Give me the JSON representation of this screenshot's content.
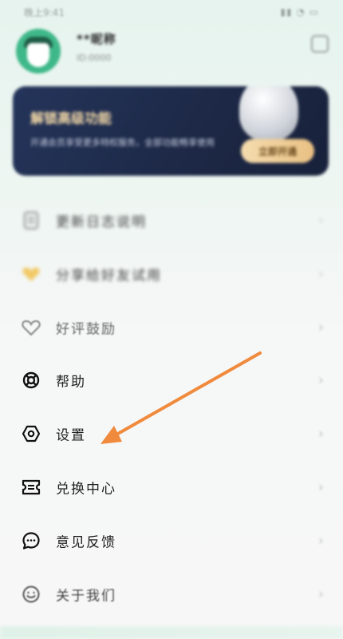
{
  "status_bar": {
    "time": "晚上9:41",
    "icons": "▮▮ ◔ ▭"
  },
  "profile": {
    "username": "**昵称",
    "user_id": "ID:0000"
  },
  "vip_card": {
    "title": "解锁高级功能",
    "description": "开通会员享受更多特权服务，全部功能畅享使用",
    "button_label": "立即开通"
  },
  "menu": {
    "items": [
      {
        "label": "更新日志说明",
        "icon": "document-icon"
      },
      {
        "label": "分享给好友试用",
        "icon": "heart-gold-icon"
      },
      {
        "label": "好评鼓励",
        "icon": "heart-outline-icon"
      },
      {
        "label": "帮助",
        "icon": "lifebuoy-icon"
      },
      {
        "label": "设置",
        "icon": "settings-hexagon-icon"
      },
      {
        "label": "兑换中心",
        "icon": "ticket-icon"
      },
      {
        "label": "意见反馈",
        "icon": "chat-bubble-icon"
      },
      {
        "label": "关于我们",
        "icon": "smiley-icon"
      }
    ],
    "chevron": "›"
  },
  "colors": {
    "arrow": "#f08a3c",
    "vip_card_bg": "#1d2947",
    "avatar_bg": "#3fb889"
  }
}
